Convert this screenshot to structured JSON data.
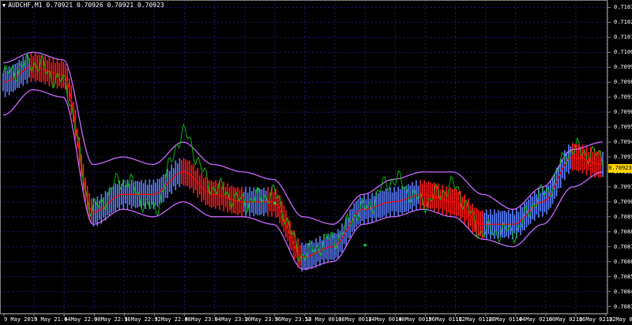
{
  "header": {
    "symbol_timeframe": "AUDCHF,M1",
    "ohlc": "0.70921 0.70926 0.70921 0.70923"
  },
  "price_axis": {
    "labels": [
      "0.71035",
      "0.71025",
      "0.71015",
      "0.71005",
      "0.70995",
      "0.70985",
      "0.70975",
      "0.70965",
      "0.70955",
      "0.70945",
      "0.70935",
      "0.70925",
      "0.70915",
      "0.70905",
      "0.70895",
      "0.70885",
      "0.70875",
      "0.70865",
      "0.70855",
      "0.70845",
      "0.70835"
    ],
    "current_price": "0.70923"
  },
  "time_axis": {
    "labels": [
      "9 May 2019",
      "9 May 21:44",
      "9 May 22:00",
      "9 May 22:16",
      "9 May 22:32",
      "9 May 22:48",
      "9 May 23:04",
      "9 May 23:20",
      "9 May 23:36",
      "9 May 23:52",
      "10 May 00:08",
      "10 May 00:24",
      "10 May 00:40",
      "10 May 00:56",
      "10 May 01:12",
      "10 May 01:28",
      "10 May 01:44",
      "10 May 02:00",
      "10 May 02:16",
      "10 May 02:32",
      "10 May 02:48"
    ]
  },
  "colors": {
    "background": "#000000",
    "grid": "#1a1a6e",
    "axis_text": "#ffffff",
    "bull_bar": "#5b7fff",
    "bear_bar": "#ff1a1a",
    "midline": "#ff0000",
    "band": "#cc66ff",
    "signal": "#00c800",
    "dot": "#00ff40",
    "price_tag": "#ffd400"
  },
  "chart_data": {
    "type": "line",
    "symbol": "AUDCHF",
    "timeframe": "M1",
    "y_range": [
      0.7083,
      0.7104
    ],
    "x": [
      "9 May 2019",
      "9 May 21:44",
      "9 May 22:00",
      "9 May 22:16",
      "9 May 22:32",
      "9 May 22:48",
      "9 May 23:04",
      "9 May 23:20",
      "9 May 23:36",
      "9 May 23:52",
      "10 May 00:08",
      "10 May 00:24",
      "10 May 00:40",
      "10 May 00:56",
      "10 May 01:12",
      "10 May 01:28",
      "10 May 01:44",
      "10 May 02:00",
      "10 May 02:16",
      "10 May 02:32",
      "10 May 02:48"
    ],
    "series": [
      {
        "role": "mid",
        "values": [
          0.70985,
          0.70995,
          0.7099,
          0.70898,
          0.7091,
          0.7091,
          0.70925,
          0.7091,
          0.70905,
          0.70905,
          0.70868,
          0.70875,
          0.709,
          0.70905,
          0.7091,
          0.70905,
          0.7089,
          0.7089,
          0.70905,
          0.70935,
          0.7093
        ]
      },
      {
        "role": "upper",
        "values": [
          0.70998,
          0.71005,
          0.71,
          0.7093,
          0.70935,
          0.7093,
          0.70945,
          0.7093,
          0.70925,
          0.7092,
          0.70895,
          0.7089,
          0.7091,
          0.7092,
          0.70925,
          0.70925,
          0.7091,
          0.709,
          0.70915,
          0.7094,
          0.70945
        ]
      },
      {
        "role": "lower",
        "values": [
          0.70963,
          0.7098,
          0.70975,
          0.7089,
          0.709,
          0.70895,
          0.70905,
          0.70895,
          0.70895,
          0.7089,
          0.7086,
          0.70865,
          0.7089,
          0.70895,
          0.709,
          0.70895,
          0.7088,
          0.70875,
          0.7089,
          0.70915,
          0.70925
        ]
      },
      {
        "role": "signal",
        "values": [
          0.7099,
          0.70998,
          0.70985,
          0.709,
          0.7092,
          0.709,
          0.7095,
          0.70915,
          0.70905,
          0.7091,
          0.7087,
          0.7088,
          0.709,
          0.7092,
          0.70905,
          0.70915,
          0.70885,
          0.70885,
          0.7091,
          0.7094,
          0.70935
        ]
      }
    ],
    "markers": [
      {
        "x": "9 May 23:52",
        "y": 0.70904
      },
      {
        "x": "10 May 00:40",
        "y": 0.70876
      }
    ],
    "grid": true
  }
}
